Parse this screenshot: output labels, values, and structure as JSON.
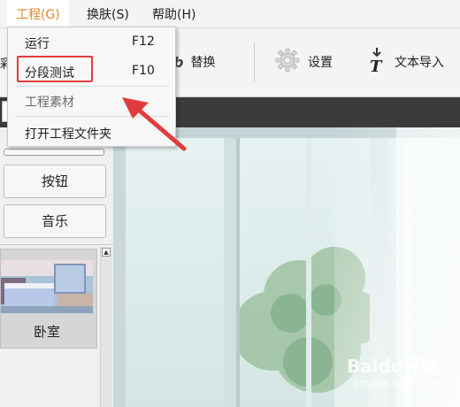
{
  "menubar": {
    "items": [
      {
        "label": "工程(G)",
        "active": true
      },
      {
        "label": "换肤(S)",
        "active": false
      },
      {
        "label": "帮助(H)",
        "active": false
      }
    ]
  },
  "toolbar": {
    "left_partial_text": "彩",
    "buttons": [
      {
        "label": "替换",
        "icon": "replace-icon"
      },
      {
        "label": "设置",
        "icon": "gear-icon"
      },
      {
        "label": "文本导入",
        "icon": "text-import-icon"
      }
    ]
  },
  "dropdown": {
    "items": [
      {
        "label": "运行",
        "shortcut": "F12",
        "enabled": true
      },
      {
        "label": "分段测试",
        "shortcut": "F10",
        "enabled": true,
        "highlighted": true
      },
      {
        "label": "工程素材",
        "shortcut": "",
        "enabled": false
      },
      {
        "label": "打开工程文件夹",
        "shortcut": "",
        "enabled": true
      }
    ]
  },
  "left_panel": {
    "buttons": [
      "按钮",
      "音乐"
    ],
    "thumbnail": {
      "label": "卧室"
    }
  },
  "watermark": {
    "text": "Baidu经验",
    "sub": "jingyan.baidu.com"
  },
  "colors": {
    "menu_active": "#e8862a",
    "highlight": "#e23b3b"
  }
}
